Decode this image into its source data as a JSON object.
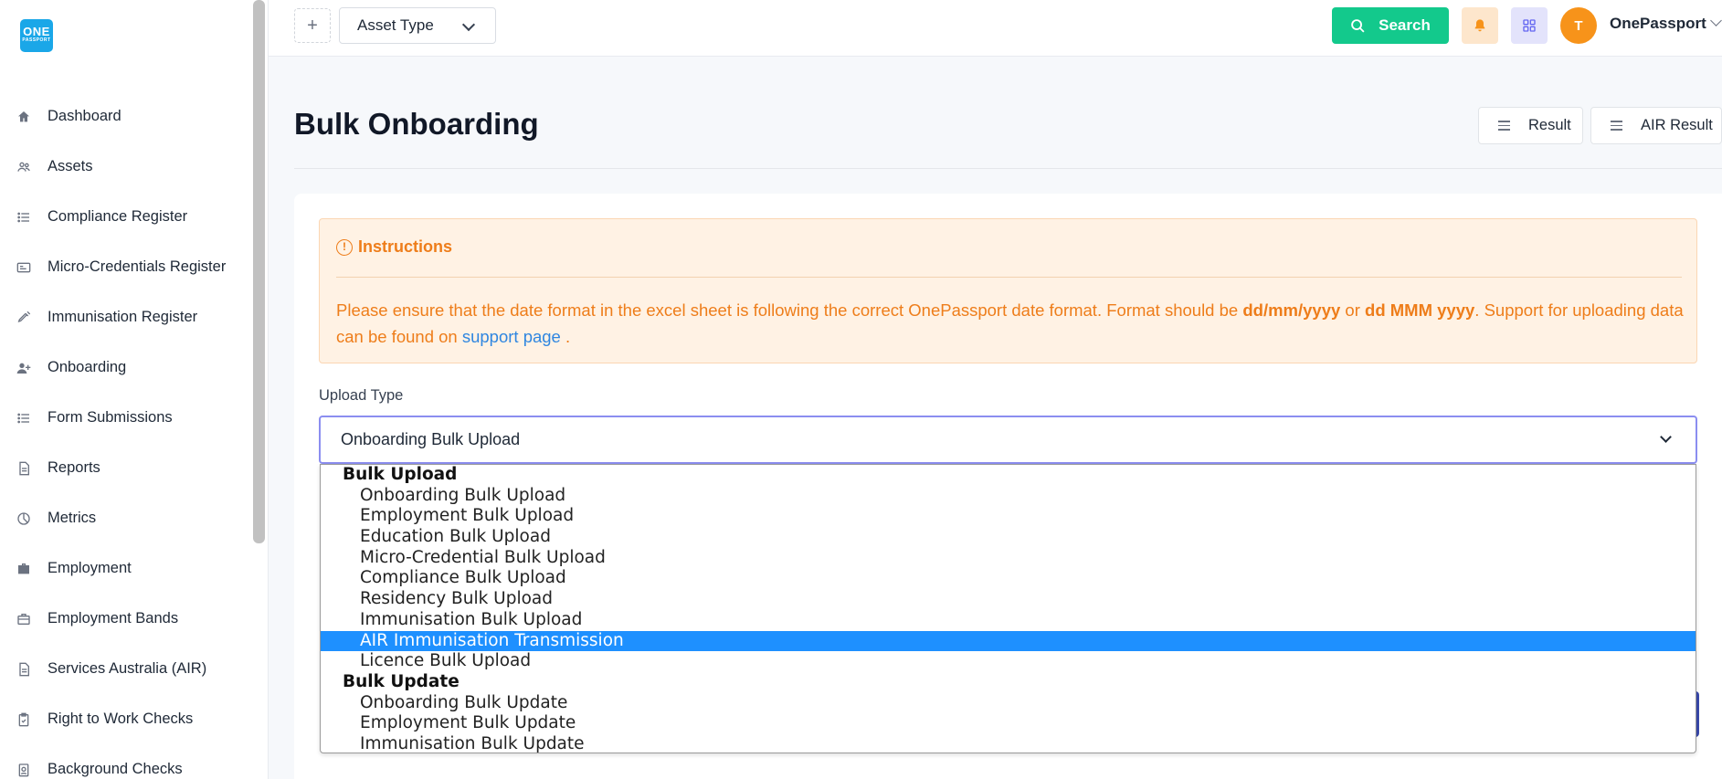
{
  "brand": {
    "logo_top": "ONE",
    "logo_bottom": "PASSPORT"
  },
  "sidebar": {
    "items": [
      {
        "label": "Dashboard",
        "icon": "home-icon"
      },
      {
        "label": "Assets",
        "icon": "users-icon"
      },
      {
        "label": "Compliance Register",
        "icon": "list-icon"
      },
      {
        "label": "Micro-Credentials Register",
        "icon": "id-card-icon"
      },
      {
        "label": "Immunisation Register",
        "icon": "syringe-icon"
      },
      {
        "label": "Onboarding",
        "icon": "user-plus-icon"
      },
      {
        "label": "Form Submissions",
        "icon": "list-icon"
      },
      {
        "label": "Reports",
        "icon": "document-icon"
      },
      {
        "label": "Metrics",
        "icon": "pie-chart-icon"
      },
      {
        "label": "Employment",
        "icon": "briefcase-icon"
      },
      {
        "label": "Employment Bands",
        "icon": "briefcase-outline-icon"
      },
      {
        "label": "Services Australia (AIR)",
        "icon": "document-icon"
      },
      {
        "label": "Right to Work Checks",
        "icon": "clipboard-check-icon"
      },
      {
        "label": "Background Checks",
        "icon": "badge-icon"
      }
    ]
  },
  "topbar": {
    "plus": "+",
    "asset_type": "Asset Type",
    "search_label": "Search",
    "avatar_initial": "T",
    "user_name": "OnePassport"
  },
  "page": {
    "title": "Bulk Onboarding",
    "result_label": "Result",
    "air_result_label": "AIR Result"
  },
  "instructions": {
    "title": "Instructions",
    "text_1": "Please ensure that the date format in the excel sheet is following the correct OnePassport date format. Format should be ",
    "format_1": "dd/mm/yyyy",
    "text_or": " or ",
    "format_2": "dd MMM yyyy",
    "text_2": ". Support for uploading data can be found on ",
    "link": "support page",
    "text_end": " ."
  },
  "upload": {
    "label": "Upload Type",
    "selected": "Onboarding Bulk Upload"
  },
  "dropdown": {
    "groups": [
      {
        "label": "Bulk Upload",
        "options": [
          "Onboarding Bulk Upload",
          "Employment Bulk Upload",
          "Education Bulk Upload",
          "Micro-Credential Bulk Upload",
          "Compliance Bulk Upload",
          "Residency Bulk Upload",
          "Immunisation Bulk Upload",
          "AIR Immunisation Transmission",
          "Licence Bulk Upload"
        ]
      },
      {
        "label": "Bulk Update",
        "options": [
          "Onboarding Bulk Update",
          "Employment Bulk Update",
          "Immunisation Bulk Update"
        ]
      }
    ],
    "highlighted": "AIR Immunisation Transmission"
  },
  "colors": {
    "accent_green": "#13c98c",
    "warning_orange": "#ee7d1a",
    "highlight_blue": "#1e90ff",
    "focus_border": "#8b8ef0"
  }
}
